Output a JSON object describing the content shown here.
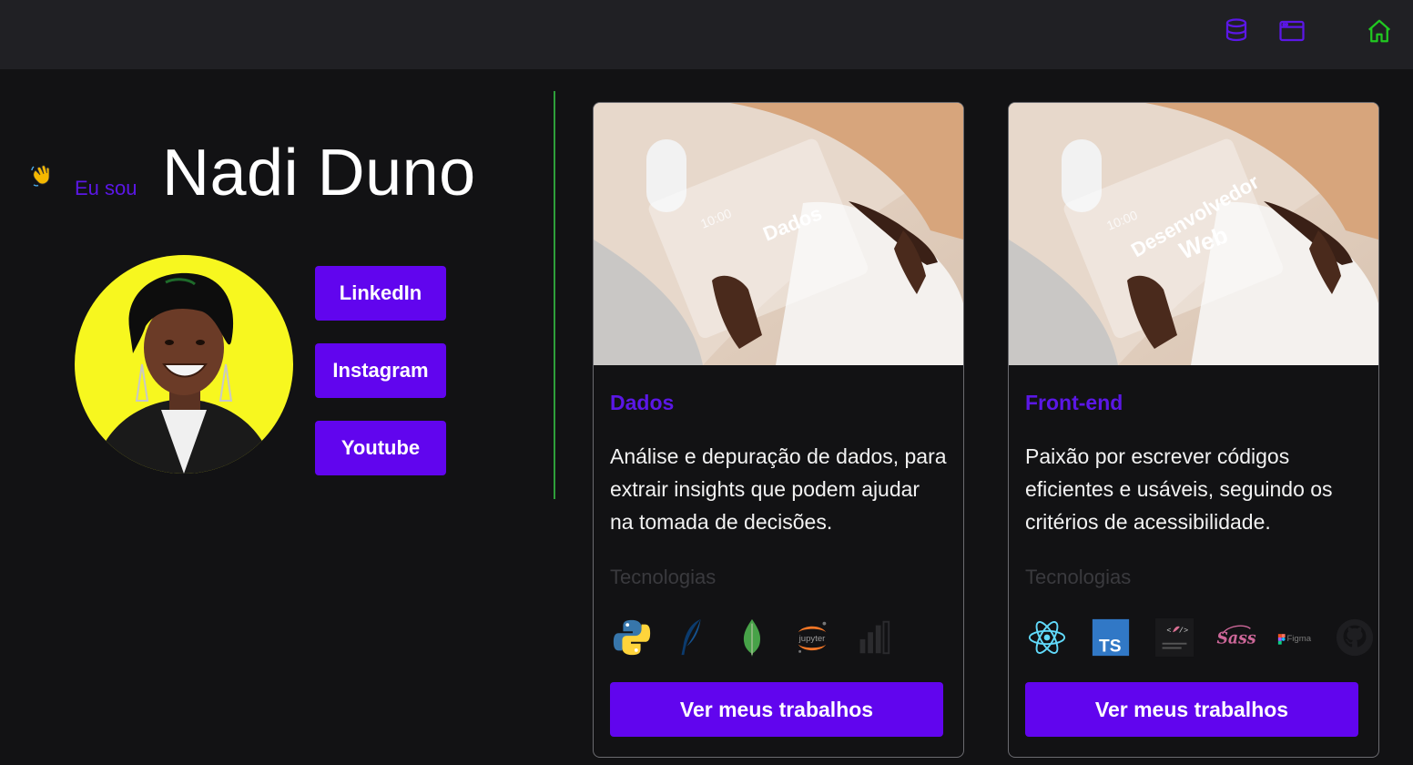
{
  "nav": {
    "icons": [
      "database-icon",
      "browser-window-icon",
      "home-icon"
    ],
    "colors": {
      "primary": "#5b17e6",
      "home": "#21c821"
    }
  },
  "hero": {
    "pre_text": "Eu sou",
    "name": "Nadi Duno",
    "wave_icon": "waving-hand-icon"
  },
  "social": {
    "linkedin": "LinkedIn",
    "instagram": "Instagram",
    "youtube": "Youtube"
  },
  "cards": [
    {
      "image_text": "Dados",
      "image_time": "10:00",
      "title": "Dados",
      "description": "Análise e depuração de dados, para extrair insights que podem ajudar na tomada de decisões.",
      "tech_label": "Tecnologias",
      "tech_icons": [
        "python-icon",
        "pandas-feather-icon",
        "mongodb-icon",
        "jupyter-icon",
        "powerbi-icon"
      ],
      "jupyter_label": "jupyter",
      "button": "Ver meus trabalhos"
    },
    {
      "image_text_line1": "Desenvolvedor",
      "image_text_line2": "Web",
      "image_time": "10:00",
      "title": "Front-end",
      "description": "Paixão por escrever códigos eficientes e usáveis, seguindo os critérios de acessibilidade.",
      "tech_label": "Tecnologias",
      "tech_icons": [
        "react-icon",
        "typescript-icon",
        "styled-components-icon",
        "sass-icon",
        "figma-icon",
        "github-icon"
      ],
      "ts_label": "TS",
      "figma_label": "Figma",
      "sass_label": "Sass",
      "button": "Ver meus trabalhos"
    }
  ],
  "colors": {
    "background": "#121214",
    "topbar": "#202024",
    "button": "#6105ee",
    "accent": "#5b17e6",
    "divider": "#2e9e3a"
  }
}
